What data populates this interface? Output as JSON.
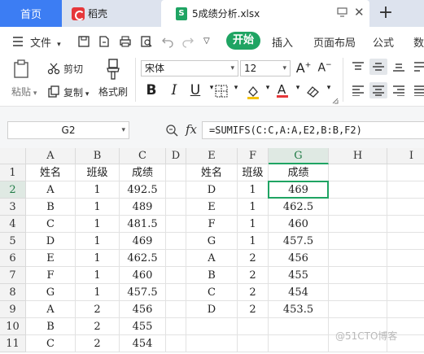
{
  "tabs": {
    "home": "首页",
    "daoke": "稻壳",
    "file": "5成绩分析.xlsx",
    "file_icon": "S"
  },
  "menu": {
    "file": "文件",
    "items": [
      "开始",
      "插入",
      "页面布局",
      "公式",
      "数"
    ]
  },
  "ribbon": {
    "paste": "粘贴",
    "cut": "剪切",
    "copy": "复制",
    "format_painter": "格式刷",
    "font_name": "宋体",
    "font_size": "12"
  },
  "formula_bar": {
    "name_box": "G2",
    "fx": "fx",
    "formula": "=SUMIFS(C:C,A:A,E2,B:B,F2)"
  },
  "grid": {
    "columns": [
      "A",
      "B",
      "C",
      "D",
      "E",
      "F",
      "G",
      "H",
      "I"
    ],
    "selected_column": "G",
    "rows": [
      {
        "n": "1",
        "cells": [
          "姓名",
          "班级",
          "成绩",
          "",
          "姓名",
          "班级",
          "成绩",
          "",
          ""
        ]
      },
      {
        "n": "2",
        "cells": [
          "A",
          "1",
          "492.5",
          "",
          "D",
          "1",
          "469",
          "",
          ""
        ]
      },
      {
        "n": "3",
        "cells": [
          "B",
          "1",
          "489",
          "",
          "E",
          "1",
          "462.5",
          "",
          ""
        ]
      },
      {
        "n": "4",
        "cells": [
          "C",
          "1",
          "481.5",
          "",
          "F",
          "1",
          "460",
          "",
          ""
        ]
      },
      {
        "n": "5",
        "cells": [
          "D",
          "1",
          "469",
          "",
          "G",
          "1",
          "457.5",
          "",
          ""
        ]
      },
      {
        "n": "6",
        "cells": [
          "E",
          "1",
          "462.5",
          "",
          "A",
          "2",
          "456",
          "",
          ""
        ]
      },
      {
        "n": "7",
        "cells": [
          "F",
          "1",
          "460",
          "",
          "B",
          "2",
          "455",
          "",
          ""
        ]
      },
      {
        "n": "8",
        "cells": [
          "G",
          "1",
          "457.5",
          "",
          "C",
          "2",
          "454",
          "",
          ""
        ]
      },
      {
        "n": "9",
        "cells": [
          "A",
          "2",
          "456",
          "",
          "D",
          "2",
          "453.5",
          "",
          ""
        ]
      },
      {
        "n": "10",
        "cells": [
          "B",
          "2",
          "455",
          "",
          "",
          "",
          "",
          "",
          ""
        ]
      },
      {
        "n": "11",
        "cells": [
          "C",
          "2",
          "454",
          "",
          "",
          "",
          "",
          "",
          ""
        ]
      }
    ]
  },
  "watermark": "@51CTO博客",
  "colors": {
    "accent_green": "#1fa463",
    "tab_blue": "#3c7df3",
    "daoke_red": "#e6373a"
  }
}
